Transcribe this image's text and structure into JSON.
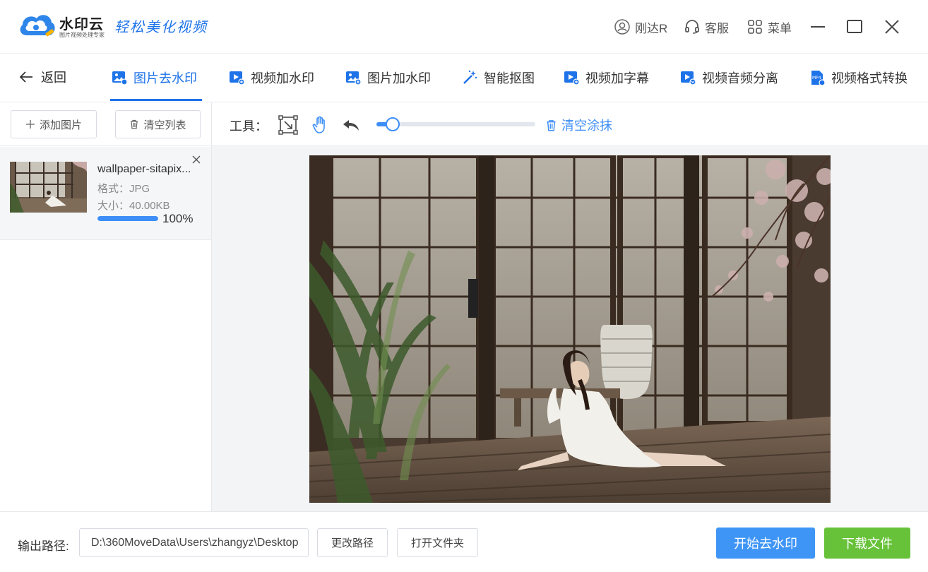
{
  "app": {
    "name": "水印云",
    "sub": "图片视频处理专家",
    "slogan": "轻松美化视频"
  },
  "titlebar": {
    "user": "刚达R",
    "service": "客服",
    "menu": "菜单"
  },
  "nav": {
    "back": "返回",
    "tabs": [
      {
        "label": "图片去水印",
        "active": true
      },
      {
        "label": "视频加水印"
      },
      {
        "label": "图片加水印"
      },
      {
        "label": "智能抠图"
      },
      {
        "label": "视频加字幕"
      },
      {
        "label": "视频音频分离"
      },
      {
        "label": "视频格式转换"
      }
    ]
  },
  "left": {
    "add_label": "添加图片",
    "clear_label": "清空列表",
    "files": [
      {
        "name": "wallpaper-sitapix...",
        "format": "格式：JPG",
        "size": "大小：40.00KB",
        "progress": 100,
        "progress_label": "100%"
      }
    ]
  },
  "tools": {
    "label": "工具：",
    "brush_level": 0.1,
    "clear_label": "清空涂抹"
  },
  "bottom": {
    "output_label": "输出路径:",
    "path": "D:\\360MoveData\\Users\\zhangyz\\Desktop",
    "change_path": "更改路径",
    "open_folder": "打开文件夹",
    "start": "开始去水印",
    "download": "下载文件"
  },
  "colors": {
    "accent": "#1e73e8",
    "primary_button": "#3e95f6",
    "download_button": "#67c23a"
  }
}
